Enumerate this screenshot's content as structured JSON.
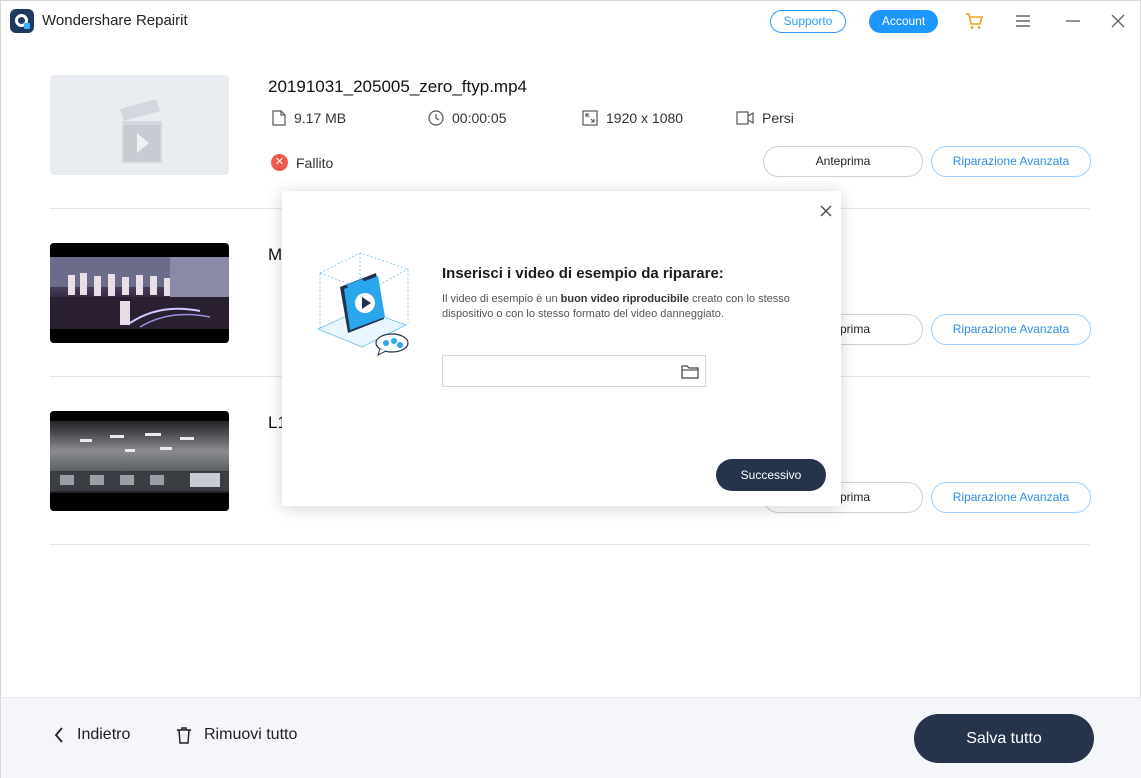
{
  "app": {
    "title": "Wondershare Repairit",
    "support_label": "Supporto",
    "account_label": "Account"
  },
  "files": [
    {
      "name": "20191031_205005_zero_ftyp.mp4",
      "size": "9.17  MB",
      "duration": "00:00:05",
      "resolution": "1920 x 1080",
      "device": "Persi",
      "status": "Fallito",
      "preview_label": "Anteprima",
      "advanced_label": "Riparazione Avanzata"
    },
    {
      "name": "M",
      "preview_label": "prima",
      "advanced_label": "Riparazione Avanzata"
    },
    {
      "name": "L1",
      "preview_label": "prima",
      "advanced_label": "Riparazione Avanzata"
    }
  ],
  "bottom": {
    "back_label": "Indietro",
    "remove_all_label": "Rimuovi tutto",
    "save_all_label": "Salva tutto"
  },
  "dialog": {
    "title": "Inserisci i video di esempio da riparare:",
    "desc_prefix": "Il video di esempio è un ",
    "desc_bold": "buon video riproducibile",
    "desc_suffix": " creato con lo stesso dispositivo o con lo stesso formato del video danneggiato.",
    "input_value": "",
    "next_label": "Successivo"
  },
  "colors": {
    "accent": "#1e96ff",
    "dark_button": "#25334b",
    "fail": "#ef5a4c"
  },
  "icons": [
    "app-logo-icon",
    "cart-icon",
    "menu-icon",
    "minimize-icon",
    "close-icon",
    "file-icon",
    "clock-icon",
    "resolution-icon",
    "video-camera-icon",
    "fail-icon",
    "chevron-left-icon",
    "trash-icon",
    "folder-icon"
  ]
}
